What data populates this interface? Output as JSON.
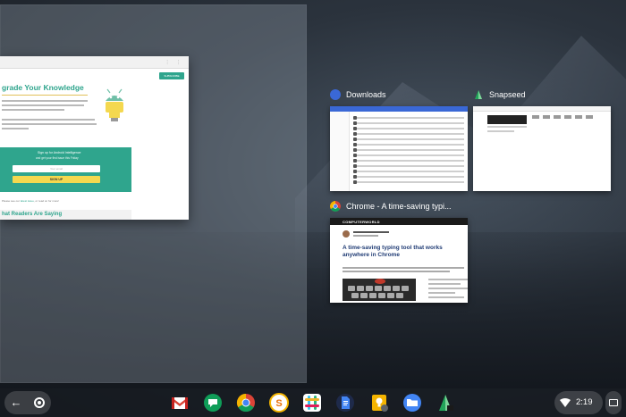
{
  "split_view": {
    "webpage": {
      "menu_dots": "⋮ ⋮",
      "subscribe_label": "SUBSCRIBE",
      "headline": "grade Your Knowledge",
      "signup_heading": "Sign up for Android Intelligence",
      "signup_sub": "and get your first issue this Friday",
      "email_placeholder": "Your email",
      "signup_button": "SIGN UP",
      "footer_prefix": "Please see our ",
      "footer_link": "latest issue",
      "footer_suffix": ", or read on for more!",
      "section_title": "hat Readers Are Saying"
    }
  },
  "overview": {
    "windows": [
      {
        "title": "Downloads",
        "app": "files-icon"
      },
      {
        "title": "Snapseed",
        "app": "snapseed-icon"
      },
      {
        "title": "Chrome - A time-saving typi...",
        "app": "chrome-icon"
      }
    ],
    "chrome_thumb": {
      "site_logo": "COMPUTERWORLD",
      "article_title": "A time-saving typing tool that works anywhere in Chrome"
    }
  },
  "shelf": {
    "back_glyph": "←",
    "apps": [
      "gmail-icon",
      "hangouts-icon",
      "chrome-icon",
      "slides-icon",
      "slack-icon",
      "docs-icon",
      "keep-icon",
      "files-icon",
      "snapseed-icon"
    ],
    "clock": "2:19"
  },
  "colors": {
    "accent_green": "#2fa58d",
    "files_blue": "#3a68d6",
    "signup_yellow": "#f4d84f"
  }
}
